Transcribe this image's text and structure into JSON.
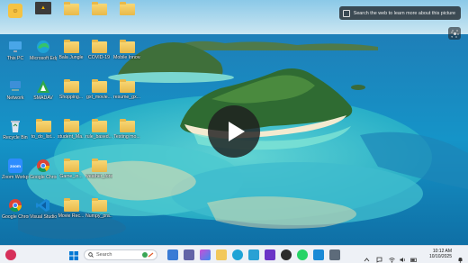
{
  "web_search": {
    "label": "Search the web to learn more about this picture"
  },
  "desktop": {
    "icons": [
      {
        "id": "row1-1",
        "label": "",
        "kind": "app-yellow"
      },
      {
        "id": "row1-2",
        "label": "",
        "kind": "image"
      },
      {
        "id": "row1-3",
        "label": "",
        "kind": "folder"
      },
      {
        "id": "row1-4",
        "label": "",
        "kind": "folder"
      },
      {
        "id": "row1-5",
        "label": "",
        "kind": "folder"
      },
      {
        "id": "this-pc",
        "label": "This PC",
        "kind": "pc"
      },
      {
        "id": "edge",
        "label": "Microsoft Edge",
        "kind": "edge"
      },
      {
        "id": "folder-2-3",
        "label": "Bala Jungle",
        "kind": "folder"
      },
      {
        "id": "folder-2-4",
        "label": "COVID-19",
        "kind": "folder"
      },
      {
        "id": "folder-2-5",
        "label": "Mobile Innovation",
        "kind": "folder"
      },
      {
        "id": "network",
        "label": "Network",
        "kind": "network"
      },
      {
        "id": "smadav",
        "label": "SMADAV",
        "kind": "smadav"
      },
      {
        "id": "shopping",
        "label": "Shopping...",
        "kind": "folder"
      },
      {
        "id": "gxt-movie",
        "label": "gxt_movie...",
        "kind": "folder"
      },
      {
        "id": "resume",
        "label": "resume_gx...",
        "kind": "folder"
      },
      {
        "id": "recycle",
        "label": "Recycle Bin",
        "kind": "recycle"
      },
      {
        "id": "todo",
        "label": "to_do_list...",
        "kind": "folder"
      },
      {
        "id": "student",
        "label": "student_Ma...",
        "kind": "folder"
      },
      {
        "id": "rule",
        "label": "rule_based...",
        "kind": "folder"
      },
      {
        "id": "testing",
        "label": "Testing mo...",
        "kind": "folder"
      },
      {
        "id": "zoom",
        "label": "Zoom Workplace",
        "kind": "zoom"
      },
      {
        "id": "chrome",
        "label": "Google Chrome",
        "kind": "chrome"
      },
      {
        "id": "game-in",
        "label": "Game_in...",
        "kind": "folder"
      },
      {
        "id": "weather",
        "label": "weather_forecast_app",
        "kind": "folder"
      },
      {
        "id": "chrome2",
        "label": "Google Chrome",
        "kind": "chrome"
      },
      {
        "id": "vscode",
        "label": "Visual Studio Code",
        "kind": "vscode"
      },
      {
        "id": "movie-rec",
        "label": "Movie Rec...",
        "kind": "folder"
      },
      {
        "id": "numpy",
        "label": "Numpy_pra...",
        "kind": "folder"
      }
    ]
  },
  "taskbar": {
    "search_placeholder": "Search",
    "time": "10:12 AM",
    "date": "10/10/2025"
  },
  "colors": {
    "taskbar_bg": "#eef1f6",
    "sea": "#1a8fc4",
    "folder": "#f2c85b"
  }
}
